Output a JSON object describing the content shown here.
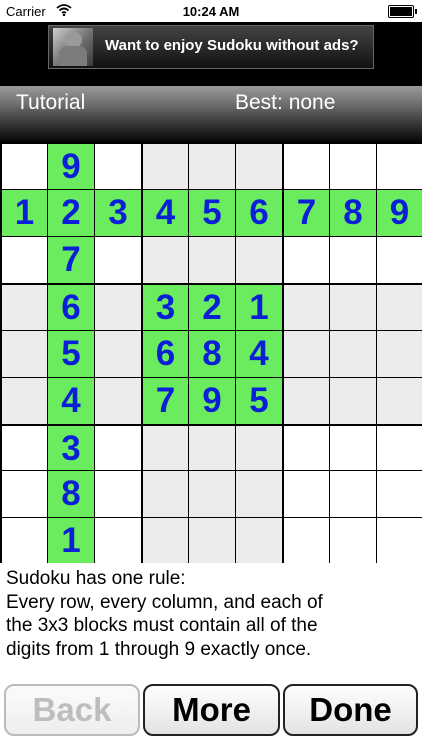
{
  "status_bar": {
    "carrier": "Carrier",
    "time": "10:24 AM"
  },
  "ad": {
    "text": "Want to enjoy Sudoku without ads?"
  },
  "header": {
    "mode": "Tutorial",
    "best": "Best: none"
  },
  "board": {
    "rows": [
      [
        "",
        "9",
        "",
        "",
        "",
        "",
        "",
        "",
        ""
      ],
      [
        "1",
        "2",
        "3",
        "4",
        "5",
        "6",
        "7",
        "8",
        "9"
      ],
      [
        "",
        "7",
        "",
        "",
        "",
        "",
        "",
        "",
        ""
      ],
      [
        "",
        "6",
        "",
        "3",
        "2",
        "1",
        "",
        "",
        ""
      ],
      [
        "",
        "5",
        "",
        "6",
        "8",
        "4",
        "",
        "",
        ""
      ],
      [
        "",
        "4",
        "",
        "7",
        "9",
        "5",
        "",
        "",
        ""
      ],
      [
        "",
        "3",
        "",
        "",
        "",
        "",
        "",
        "",
        ""
      ],
      [
        "",
        "8",
        "",
        "",
        "",
        "",
        "",
        "",
        ""
      ],
      [
        "",
        "1",
        "",
        "",
        "",
        "",
        "",
        "",
        ""
      ]
    ],
    "highlighted": [
      [
        0,
        1
      ],
      [
        1,
        0
      ],
      [
        1,
        1
      ],
      [
        1,
        2
      ],
      [
        1,
        3
      ],
      [
        1,
        4
      ],
      [
        1,
        5
      ],
      [
        1,
        6
      ],
      [
        1,
        7
      ],
      [
        1,
        8
      ],
      [
        2,
        1
      ],
      [
        3,
        1
      ],
      [
        3,
        3
      ],
      [
        3,
        4
      ],
      [
        3,
        5
      ],
      [
        4,
        1
      ],
      [
        4,
        3
      ],
      [
        4,
        4
      ],
      [
        4,
        5
      ],
      [
        5,
        1
      ],
      [
        5,
        3
      ],
      [
        5,
        4
      ],
      [
        5,
        5
      ],
      [
        6,
        1
      ],
      [
        7,
        1
      ],
      [
        8,
        1
      ]
    ],
    "colors": {
      "highlight": "#6bec5f",
      "digit": "#0a1fd6",
      "shaded_block": "#ececec",
      "plain_block": "#ffffff"
    }
  },
  "rules": {
    "lines": [
      "Sudoku has one rule:",
      "Every row, every column, and each of",
      "the 3x3 blocks must contain all of the",
      "digits from 1 through 9 exactly once."
    ]
  },
  "buttons": {
    "back": "Back",
    "more": "More",
    "done": "Done"
  }
}
